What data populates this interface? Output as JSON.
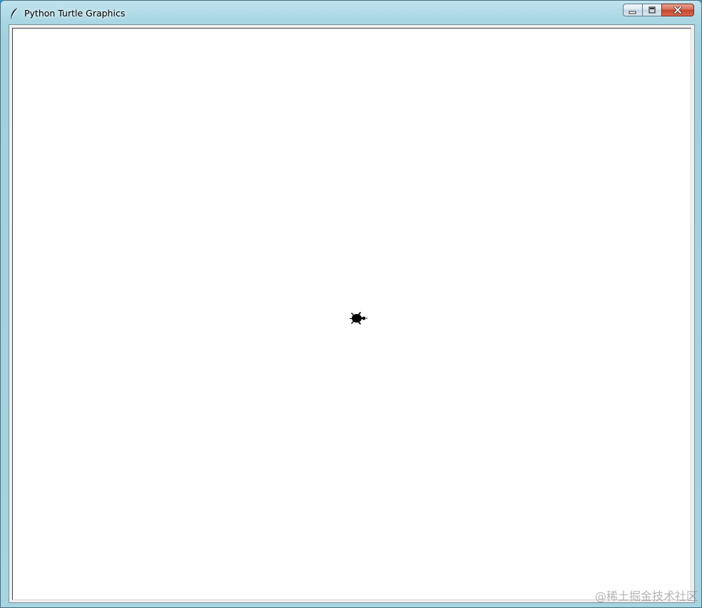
{
  "window": {
    "title": "Python Turtle Graphics",
    "icon": "feather-icon",
    "caption_buttons": [
      "minimize-icon",
      "maximize-icon",
      "close-icon"
    ]
  },
  "canvas": {
    "background": "#ffffff",
    "turtle_shape": "turtle",
    "turtle_color": "#000000"
  },
  "watermark": {
    "text": "@稀土掘金技术社区"
  }
}
